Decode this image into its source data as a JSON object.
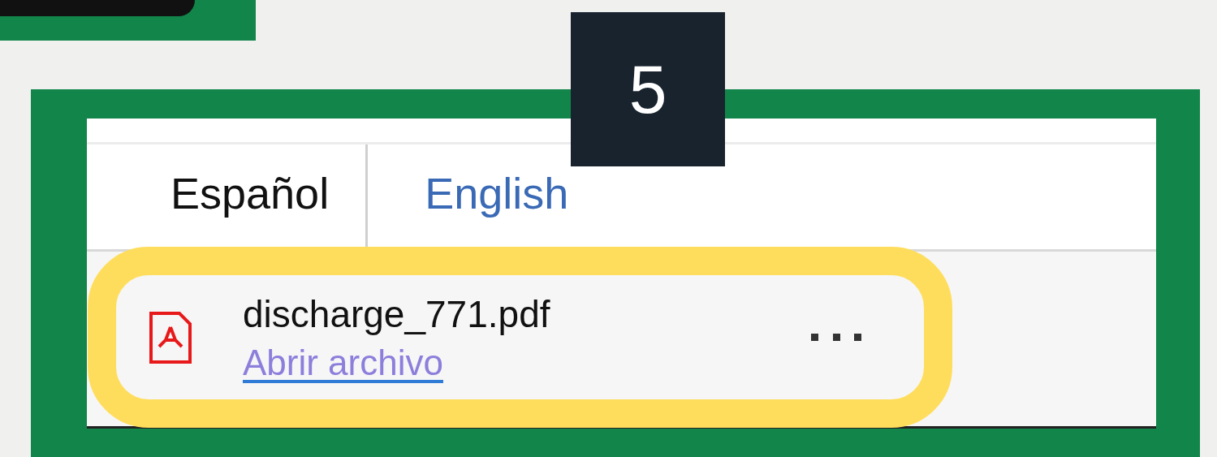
{
  "step_badge": "5",
  "languages": [
    {
      "label": "Español",
      "selected": true
    },
    {
      "label": "English",
      "selected": false
    }
  ],
  "download": {
    "filename": "discharge_771.pdf",
    "action": "Abrir archivo",
    "highlighted": true
  }
}
